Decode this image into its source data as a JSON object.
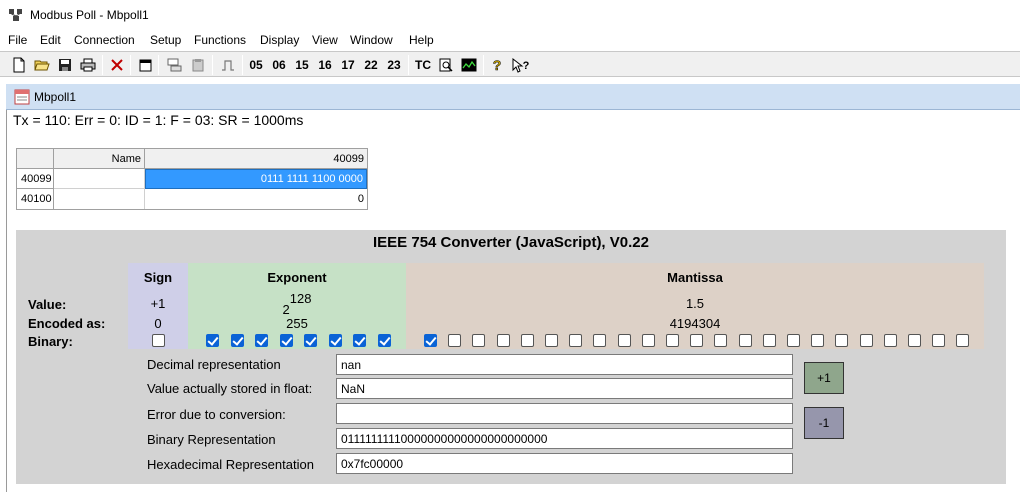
{
  "app": {
    "title": "Modbus Poll - Mbpoll1"
  },
  "menu": [
    "File",
    "Edit",
    "Connection",
    "Setup",
    "Functions",
    "Display",
    "View",
    "Window",
    "Help"
  ],
  "toolbar": {
    "function_codes": [
      "05",
      "06",
      "15",
      "16",
      "17",
      "22",
      "23"
    ],
    "tc_label": "TC"
  },
  "document": {
    "title": "Mbpoll1",
    "status": "Tx = 110: Err = 0: ID = 1: F = 03: SR = 1000ms"
  },
  "grid": {
    "name_header": "Name",
    "value_header": "40099",
    "rows": [
      {
        "address": "40099",
        "name": "",
        "value": "0111 1111 1100 0000"
      },
      {
        "address": "40100",
        "name": "",
        "value": "0"
      }
    ]
  },
  "converter": {
    "title": "IEEE 754 Converter (JavaScript), V0.22",
    "row_labels": {
      "value": "Value:",
      "encoded": "Encoded as:",
      "binary": "Binary:"
    },
    "sign": {
      "header": "Sign",
      "value": "+1",
      "encoded": "0",
      "bits": [
        0
      ]
    },
    "exponent": {
      "header": "Exponent",
      "value_base": "2",
      "value_power": "128",
      "encoded": "255",
      "bits": [
        1,
        1,
        1,
        1,
        1,
        1,
        1,
        1
      ]
    },
    "mantissa": {
      "header": "Mantissa",
      "value": "1.5",
      "encoded": "4194304",
      "bits": [
        1,
        0,
        0,
        0,
        0,
        0,
        0,
        0,
        0,
        0,
        0,
        0,
        0,
        0,
        0,
        0,
        0,
        0,
        0,
        0,
        0,
        0,
        0
      ]
    },
    "fields": [
      {
        "label": "Decimal representation",
        "value": "nan"
      },
      {
        "label": "Value actually stored in float:",
        "value": "NaN"
      },
      {
        "label": "Error due to conversion:",
        "value": ""
      },
      {
        "label": "Binary Representation",
        "value": "01111111110000000000000000000000"
      },
      {
        "label": "Hexadecimal Representation",
        "value": "0x7fc00000"
      }
    ],
    "plus_label": "+1",
    "minus_label": "-1"
  }
}
